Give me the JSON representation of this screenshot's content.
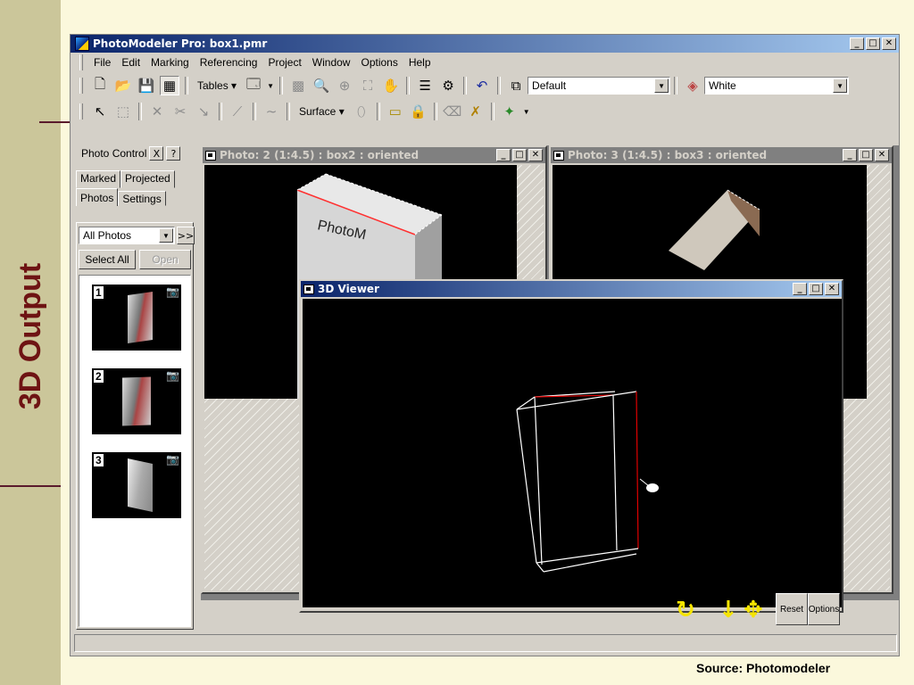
{
  "slide": {
    "title": "3D Output",
    "source": "Source: Photomodeler"
  },
  "app": {
    "title": "PhotoModeler Pro: box1.pmr",
    "window_buttons": {
      "minimize": "_",
      "maximize": "□",
      "close": "✕"
    }
  },
  "menu": [
    "File",
    "Edit",
    "Marking",
    "Referencing",
    "Project",
    "Window",
    "Options",
    "Help"
  ],
  "toolbar1": {
    "tables_label": "Tables",
    "combo1_value": "Default",
    "combo2_value": "White"
  },
  "toolbar2": {
    "surface_label": "Surface"
  },
  "photo_control": {
    "title": "Photo Control",
    "close_glyph": "X",
    "help_glyph": "?",
    "tabs_top": [
      "Marked",
      "Projected"
    ],
    "tabs_bottom": [
      "Photos",
      "Settings"
    ],
    "filter_value": "All Photos",
    "more_glyph": ">>",
    "select_all_label": "Select All",
    "open_label": "Open",
    "thumbnails": [
      {
        "number": "1"
      },
      {
        "number": "2"
      },
      {
        "number": "3"
      }
    ]
  },
  "photo2": {
    "title": "Photo: 2 (1:4.5) : box2 : oriented",
    "label_on_box": "PhotoM"
  },
  "photo3": {
    "title": "Photo: 3 (1:4.5) : box3 : oriented"
  },
  "viewer": {
    "title": "3D Viewer",
    "reset_label": "Reset",
    "options_label": "Options",
    "edge_color_main": "#ffffff",
    "edge_color_selected": "#e00000",
    "tool_icon_color": "#f5e400"
  }
}
